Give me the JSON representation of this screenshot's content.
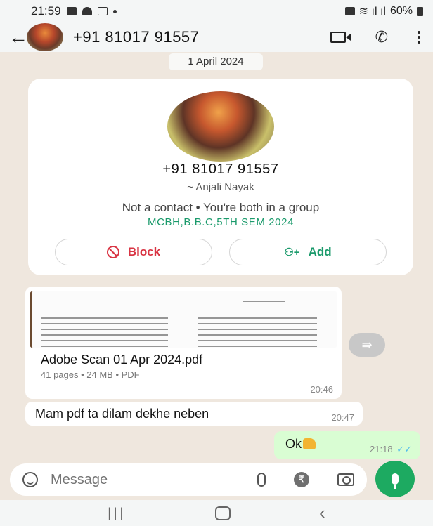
{
  "status_bar": {
    "time": "21:59",
    "right_text": "60%"
  },
  "header": {
    "title": "+91 81017 91557"
  },
  "date_chip": "1 April 2024",
  "contact_card": {
    "phone": "+91 81017 91557",
    "alias": "~ Anjali Nayak",
    "note": "Not a contact • You're both in a group",
    "group_name": "MCBH,B.B.C,5TH SEM 2024",
    "block_label": "Block",
    "add_label": "Add"
  },
  "messages": [
    {
      "type": "document",
      "file_name": "Adobe Scan 01 Apr 2024.pdf",
      "meta": "41 pages • 24 MB • PDF",
      "time": "20:46"
    },
    {
      "type": "text",
      "text": "Mam pdf ta dilam dekhe neben",
      "time": "20:47"
    },
    {
      "type": "text_out",
      "text": "Ok",
      "time": "21:18"
    }
  ],
  "composer": {
    "placeholder": "Message"
  },
  "colors": {
    "accent_green": "#1daa61",
    "block_red": "#d93544",
    "outgoing_bubble": "#d9fdd3",
    "wallpaper": "#efe7de"
  },
  "icons": [
    "back-arrow-icon",
    "video-call-icon",
    "voice-call-icon",
    "menu-icon",
    "block-icon",
    "add-user-icon",
    "forward-icon",
    "emoji-icon",
    "attach-icon",
    "rupee-icon",
    "camera-icon",
    "mic-icon"
  ]
}
